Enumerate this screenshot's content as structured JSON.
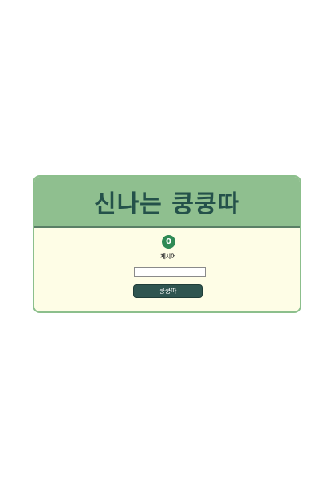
{
  "game": {
    "title": "신나는 쿵쿵따",
    "count": "0",
    "current_word": "제시어",
    "input_value": "",
    "input_placeholder": "",
    "submit_label": "쿵쿵따"
  },
  "colors": {
    "header_bg": "#8fbf8f",
    "body_bg": "#fefde6",
    "title_color": "#24514a",
    "counter_bg": "#2f8a55",
    "button_bg": "#2f5550"
  }
}
